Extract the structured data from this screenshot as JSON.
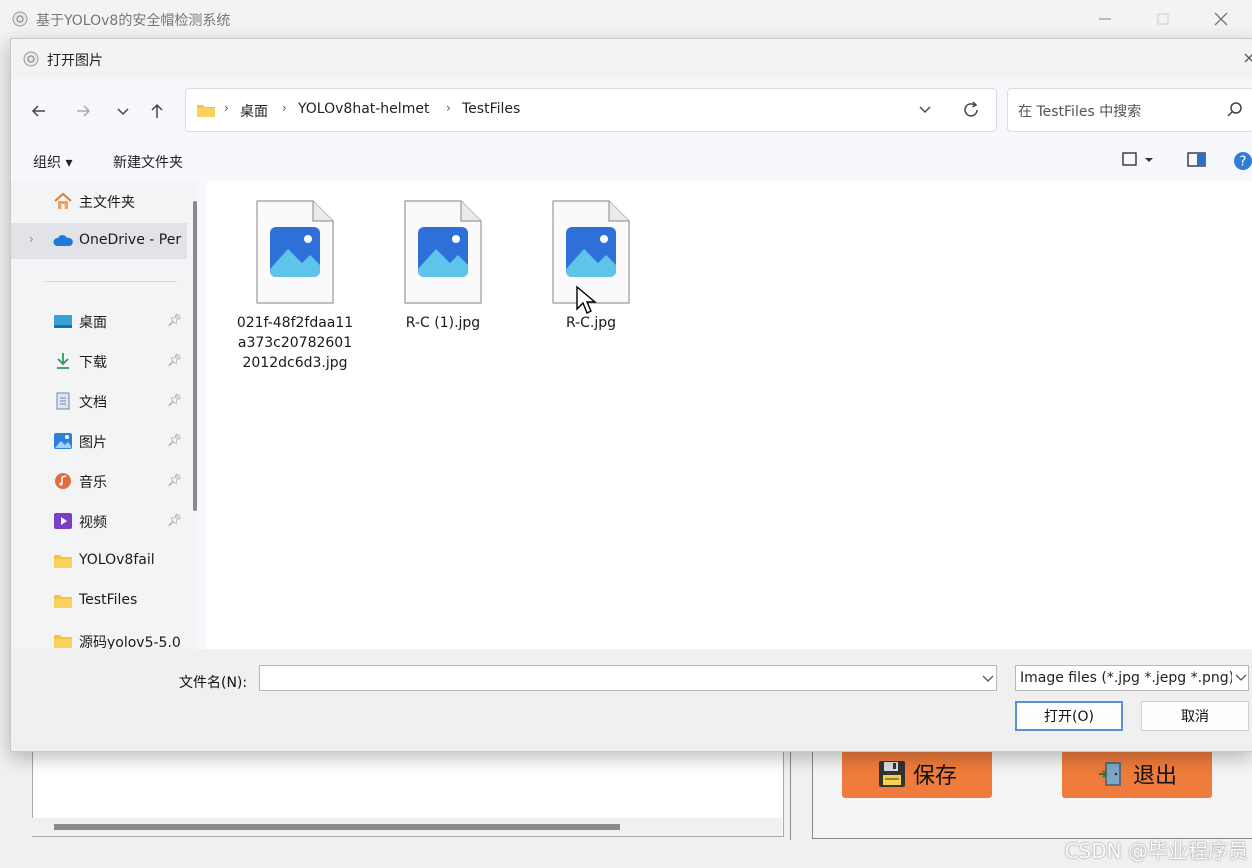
{
  "app": {
    "title": "基于YOLOv8的安全帽检测系统",
    "save_label": "保存",
    "exit_label": "退出",
    "watermark": "CSDN @毕业程序员"
  },
  "dialog": {
    "title": "打开图片",
    "breadcrumbs": [
      "桌面",
      "YOLOv8hat-helmet",
      "TestFiles"
    ],
    "search_placeholder": "在 TestFiles 中搜索",
    "toolbar": {
      "organize": "组织 ▾",
      "new_folder": "新建文件夹"
    },
    "nav_items": [
      {
        "label": "主文件夹",
        "icon": "home-icon",
        "pinned": false
      },
      {
        "label": "OneDrive - Per",
        "icon": "onedrive-icon",
        "pinned": false,
        "selected": true
      },
      {
        "label": "桌面",
        "icon": "desktop-icon",
        "pinned": true
      },
      {
        "label": "下载",
        "icon": "download-icon",
        "pinned": true
      },
      {
        "label": "文档",
        "icon": "document-icon",
        "pinned": true
      },
      {
        "label": "图片",
        "icon": "pictures-icon",
        "pinned": true
      },
      {
        "label": "音乐",
        "icon": "music-icon",
        "pinned": true
      },
      {
        "label": "视频",
        "icon": "video-icon",
        "pinned": true
      },
      {
        "label": "YOLOv8fail",
        "icon": "folder-icon",
        "pinned": false
      },
      {
        "label": "TestFiles",
        "icon": "folder-icon",
        "pinned": false
      },
      {
        "label": "源码yolov5-5.0",
        "icon": "folder-icon",
        "pinned": false
      }
    ],
    "files": [
      {
        "name": "021f-48f2fdaa11a373c207826012012dc6d3.jpg"
      },
      {
        "name": "R-C (1).jpg"
      },
      {
        "name": "R-C.jpg"
      }
    ],
    "filename_label": "文件名(N):",
    "filename_value": "",
    "filetype": "Image files (*.jpg *.jepg *.png)",
    "open_label": "打开(O)",
    "cancel_label": "取消"
  }
}
